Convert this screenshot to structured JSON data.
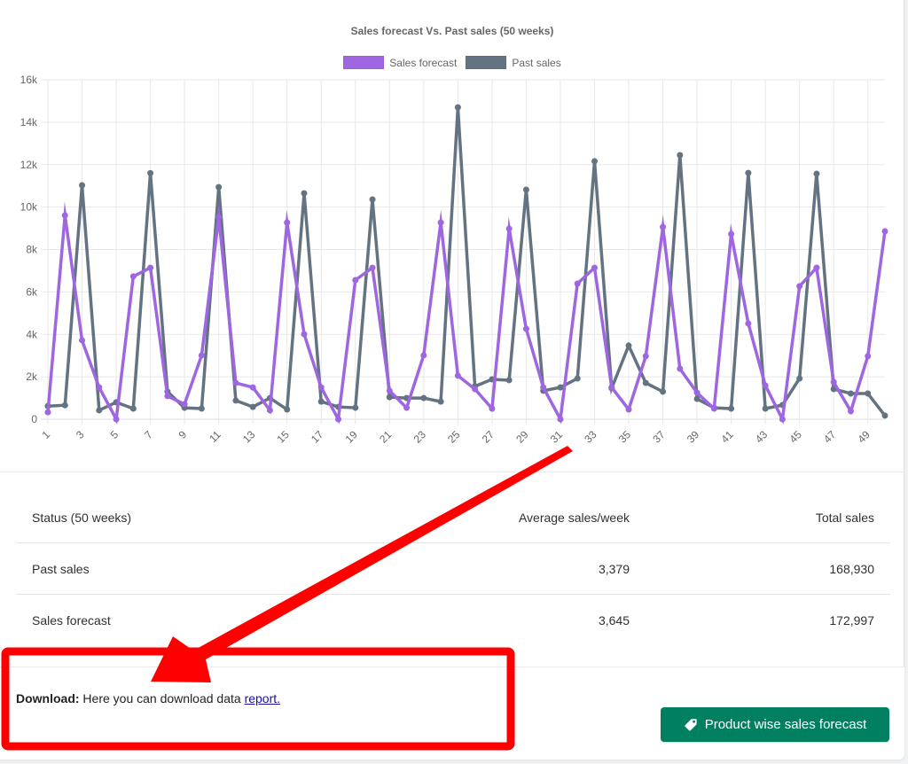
{
  "chart_data": {
    "type": "line",
    "title": "Sales forecast Vs. Past sales (50 weeks)",
    "xlabel": "",
    "ylabel": "",
    "ylim": [
      0,
      16000
    ],
    "yticks": [
      "0",
      "2k",
      "4k",
      "6k",
      "8k",
      "10k",
      "12k",
      "14k",
      "16k"
    ],
    "ytick_values": [
      0,
      2000,
      4000,
      6000,
      8000,
      10000,
      12000,
      14000,
      16000
    ],
    "x": [
      1,
      2,
      3,
      4,
      5,
      6,
      7,
      8,
      9,
      10,
      11,
      12,
      13,
      14,
      15,
      16,
      17,
      18,
      19,
      20,
      21,
      22,
      23,
      24,
      25,
      26,
      27,
      28,
      29,
      30,
      31,
      32,
      33,
      34,
      35,
      36,
      37,
      38,
      39,
      40,
      41,
      42,
      43,
      44,
      45,
      46,
      47,
      48,
      49,
      50
    ],
    "xtick_labels": [
      "1",
      "3",
      "5",
      "7",
      "9",
      "11",
      "13",
      "15",
      "17",
      "19",
      "21",
      "23",
      "25",
      "27",
      "29",
      "31",
      "33",
      "35",
      "37",
      "39",
      "41",
      "43",
      "45",
      "47",
      "49"
    ],
    "grid": true,
    "legend_position": "top-center",
    "series": [
      {
        "name": "Sales forecast",
        "color": "#9e66e0",
        "values": [
          330,
          9610,
          3720,
          1500,
          0,
          6730,
          7140,
          1090,
          710,
          3010,
          9520,
          1710,
          1500,
          420,
          9270,
          4010,
          1500,
          0,
          6560,
          7140,
          1340,
          540,
          3010,
          9270,
          2050,
          1420,
          500,
          8980,
          4260,
          1500,
          0,
          6390,
          7140,
          1500,
          460,
          2970,
          9060,
          2380,
          1250,
          500,
          8730,
          4510,
          1590,
          0,
          6270,
          7140,
          1750,
          380,
          2970,
          8860
        ]
      },
      {
        "name": "Past sales",
        "color": "#637381",
        "values": [
          620,
          660,
          11030,
          420,
          800,
          500,
          11600,
          1300,
          540,
          500,
          10940,
          880,
          580,
          1000,
          460,
          10650,
          830,
          580,
          540,
          10360,
          1040,
          1000,
          1000,
          830,
          14700,
          1550,
          1880,
          1840,
          10820,
          1340,
          1500,
          1920,
          12160,
          1460,
          3470,
          1710,
          1300,
          12450,
          960,
          540,
          500,
          11610,
          500,
          670,
          1920,
          11570,
          1420,
          1210,
          1210,
          170
        ]
      }
    ]
  },
  "stats": {
    "headers": [
      "Status (50 weeks)",
      "Average sales/week",
      "Total sales"
    ],
    "rows": [
      {
        "label": "Past sales",
        "average": "3,379",
        "total": "168,930"
      },
      {
        "label": "Sales forecast",
        "average": "3,645",
        "total": "172,997"
      }
    ]
  },
  "footer": {
    "download_label": "Download:",
    "download_text": " Here you can download data ",
    "download_link": "report.",
    "button_label": "Product wise sales forecast",
    "button_icon": "tag-icon",
    "button_color": "#008060"
  },
  "annotation": {
    "color": "#ff0000",
    "shapes": [
      "arrow",
      "highlight-box"
    ]
  }
}
